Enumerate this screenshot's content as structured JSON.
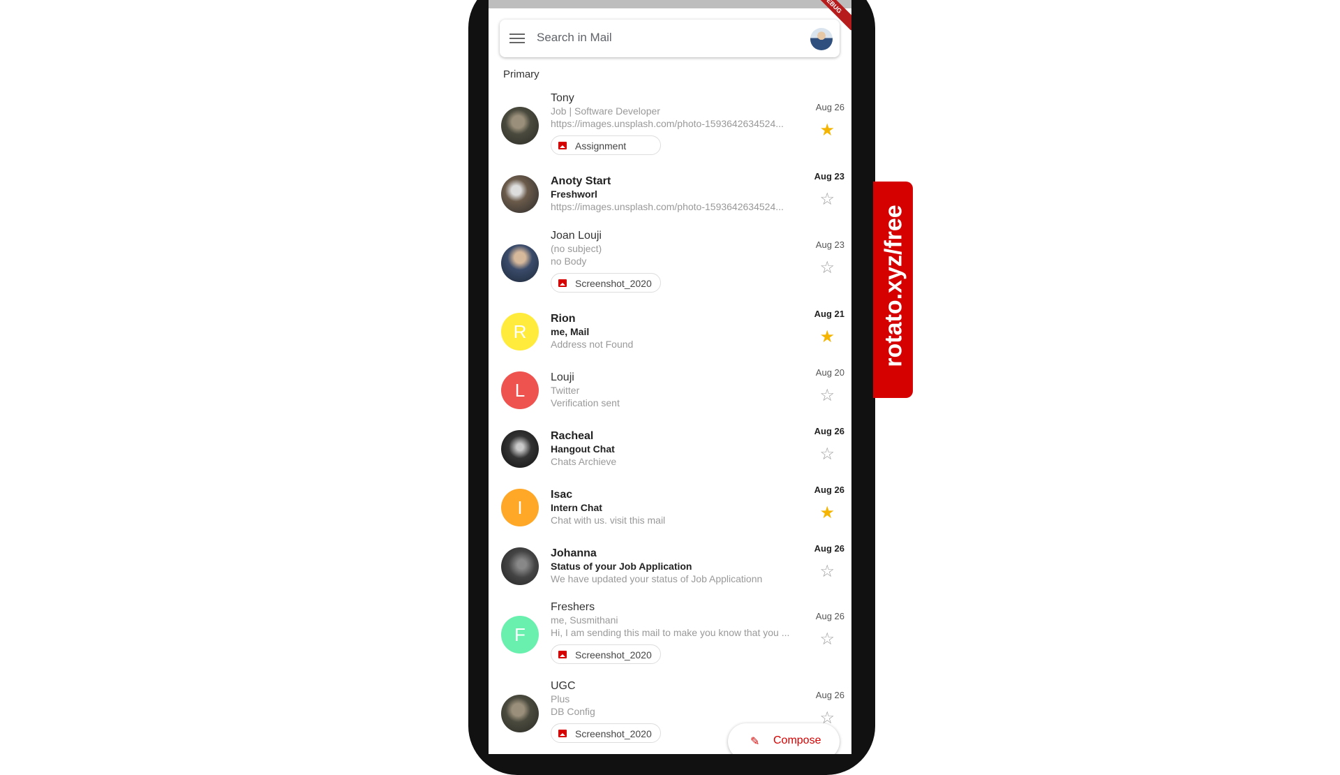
{
  "search": {
    "placeholder": "Search in Mail"
  },
  "section_label": "Primary",
  "colors": {
    "accent": "#d50000",
    "star": "#f4b400",
    "avatar_yellow": "#ffeb3b",
    "avatar_red": "#ef5350",
    "avatar_orange": "#ffa726",
    "avatar_green": "#69f0ae"
  },
  "mails": [
    {
      "sender": "Tony",
      "subject": "Job | Software Developer",
      "snippet": "https://images.unsplash.com/photo-1593642634524...",
      "date": "Aug 26",
      "starred": true,
      "unread": false,
      "attachment": "Assignment",
      "avatar": "photo-a"
    },
    {
      "sender": "Anoty Start",
      "subject": "Freshworl",
      "snippet": "https://images.unsplash.com/photo-1593642634524...",
      "date": "Aug 23",
      "starred": false,
      "unread": true,
      "avatar": "photo-b"
    },
    {
      "sender": "Joan Louji",
      "subject": "(no subject)",
      "snippet": "no Body",
      "date": "Aug 23",
      "starred": false,
      "unread": false,
      "attachment": "Screenshot_2020",
      "avatar": "photo-c"
    },
    {
      "sender": "Rion",
      "subject": "me, Mail",
      "snippet": "Address not Found",
      "date": "Aug 21",
      "starred": true,
      "unread": true,
      "avatar_letter": "R",
      "avatar_color": "#ffeb3b"
    },
    {
      "sender": "Louji",
      "subject": "Twitter",
      "snippet": "Verification sent",
      "date": "Aug 20",
      "starred": false,
      "unread": false,
      "avatar_letter": "L",
      "avatar_color": "#ef5350"
    },
    {
      "sender": "Racheal",
      "subject": "Hangout Chat",
      "snippet": "Chats Archieve",
      "date": "Aug 26",
      "starred": false,
      "unread": true,
      "avatar": "photo-d"
    },
    {
      "sender": "Isac",
      "subject": "Intern Chat",
      "snippet": "Chat with us. visit this mail",
      "date": "Aug 26",
      "starred": true,
      "unread": true,
      "avatar_letter": "I",
      "avatar_color": "#ffa726"
    },
    {
      "sender": "Johanna",
      "subject": "Status of your Job Application",
      "snippet": "We have updated your status of Job Applicationn",
      "date": "Aug 26",
      "starred": false,
      "unread": true,
      "avatar": "photo-e"
    },
    {
      "sender": "Freshers",
      "subject": "me, Susmithani",
      "snippet": "Hi, I am sending this mail to make you know that you ...",
      "date": "Aug 26",
      "starred": false,
      "unread": false,
      "attachment": "Screenshot_2020",
      "avatar_letter": "F",
      "avatar_color": "#69f0ae"
    },
    {
      "sender": "UGC",
      "subject": "Plus",
      "snippet": "DB Config",
      "date": "Aug 26",
      "starred": false,
      "unread": false,
      "attachment": "Screenshot_2020",
      "avatar": "photo-a"
    }
  ],
  "compose": {
    "label": "Compose"
  },
  "watermark": "rotato.xyz/free",
  "ribbon": "DEBUG"
}
